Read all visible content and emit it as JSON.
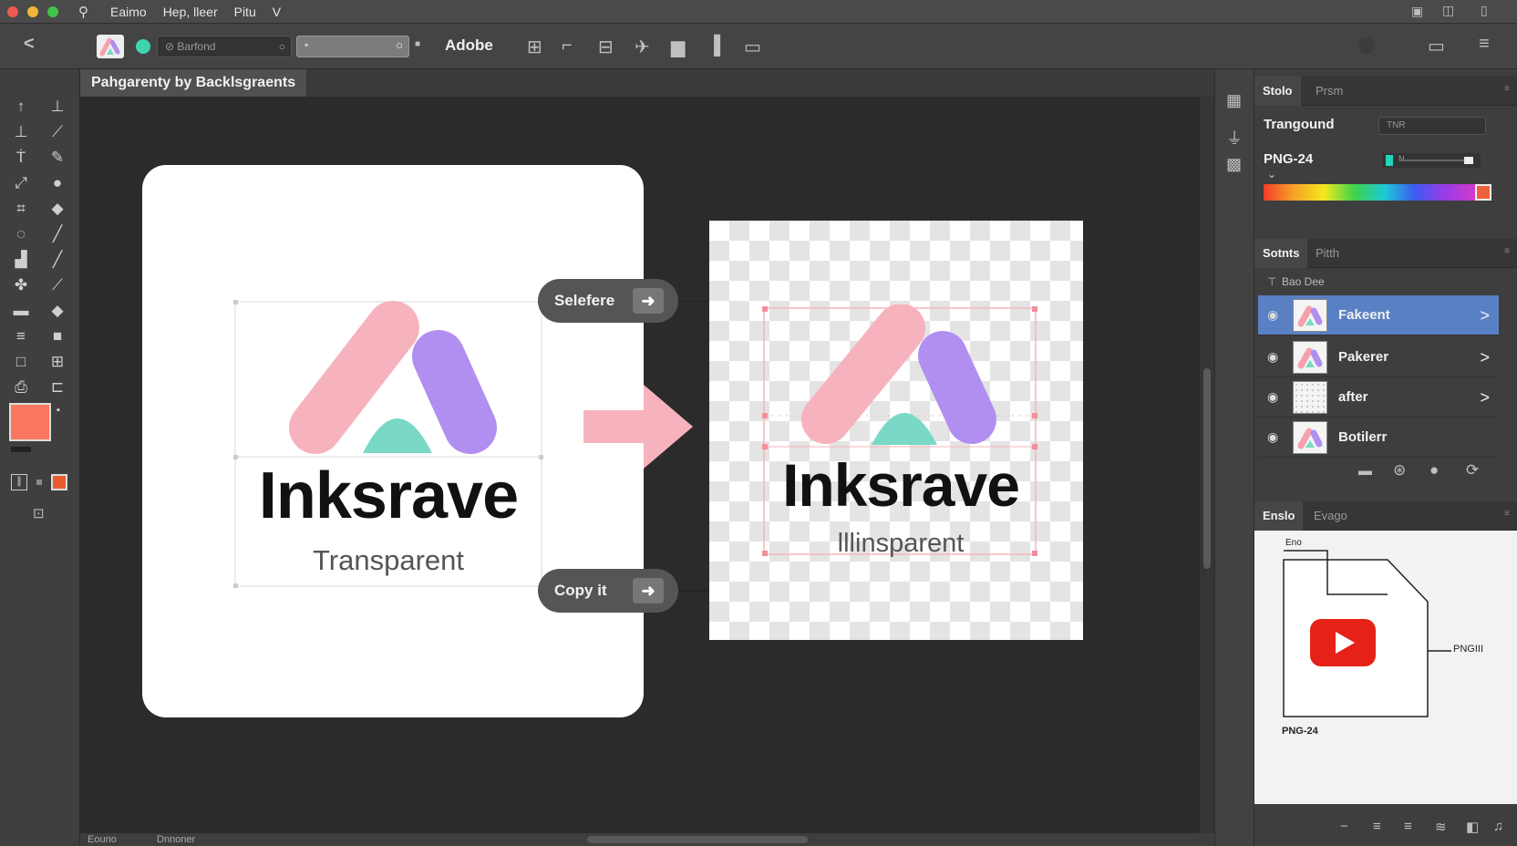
{
  "window": {
    "menu": [
      "Eaimo",
      "Hep, lleer",
      "Pitu",
      "V"
    ]
  },
  "optionsbar": {
    "back_icon": "back-arrow-icon",
    "search_placeholder": "Barfond",
    "brand_label": "Adobe"
  },
  "document": {
    "tab_title": "Pahgarenty by Backlsgraents",
    "statusbar": [
      "Eouno",
      "Dnnoner"
    ]
  },
  "artwork": {
    "left_wordmark": "Inksrave",
    "left_subtitle": "Transparent",
    "right_wordmark": "Inksrave",
    "right_subtitle": "lllinsparent",
    "callout_top": "Selefere",
    "callout_bottom": "Copy it"
  },
  "properties_panel": {
    "tabs": [
      "Stolo",
      "Prsm"
    ],
    "row1_label": "Trangound",
    "row1_value": "TNR",
    "row2_label": "PNG-24",
    "row2_value": "N"
  },
  "layers_panel": {
    "tabs": [
      "Sotnts",
      "Pitth"
    ],
    "filter_label": "Bao Dee",
    "layers": [
      {
        "name": "Fakeent",
        "selected": true
      },
      {
        "name": "Pakerer",
        "selected": false
      },
      {
        "name": "after",
        "selected": false
      },
      {
        "name": "Botilerr",
        "selected": false
      }
    ]
  },
  "export_panel": {
    "tabs": [
      "Enslo",
      "Evago"
    ],
    "file_label": "Eno",
    "side_label": "PNGIII",
    "format_label": "PNG-24"
  },
  "colors": {
    "accent": "#5a80c4",
    "pink": "#f7b3bd",
    "purple": "#b18ff0",
    "teal": "#79d9c6",
    "fg_swatch": "#f9785f",
    "youtube": "#e62117"
  }
}
